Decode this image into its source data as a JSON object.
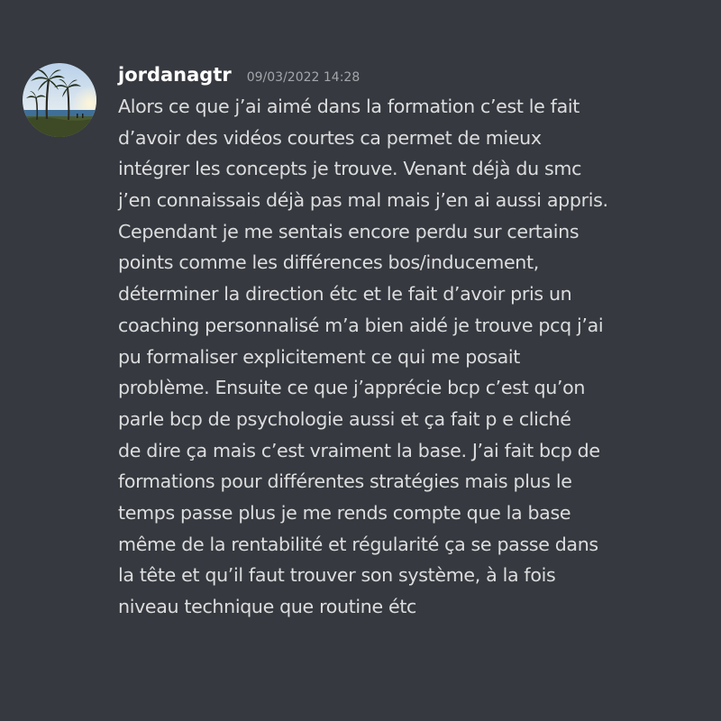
{
  "message": {
    "author": "jordanagtr",
    "timestamp": "09/03/2022 14:28",
    "avatar_icon": "palm-trees-beach-avatar-icon",
    "lines": [
      "Alors ce que j’ai aimé dans la formation c’est le fait",
      "d’avoir des vidéos courtes ca permet de mieux",
      "intégrer les concepts je trouve. Venant déjà du smc",
      "j’en connaissais déjà pas mal mais j’en ai aussi appris.",
      "Cependant je me sentais encore perdu sur certains",
      "points comme les différences bos/inducement,",
      "déterminer la direction étc et le fait d’avoir pris un",
      "coaching personnalisé m’a bien aidé je trouve pcq j’ai",
      "pu formaliser explicitement ce qui me posait",
      "problème. Ensuite ce que j’apprécie bcp c’est qu’on",
      "parle bcp de psychologie aussi et ça fait p e cliché",
      "de dire ça mais c’est vraiment la base. J’ai fait bcp de",
      "formations pour différentes stratégies mais plus le",
      "temps passe plus je me rends compte que la base",
      "même de la rentabilité et régularité ça se passe dans",
      "la tête et qu’il faut trouver son système, à la fois",
      "niveau technique que routine étc"
    ]
  },
  "colors": {
    "background": "#36393f",
    "username": "#ffffff",
    "timestamp": "#a3a6aa",
    "message_text": "#dcddde"
  }
}
